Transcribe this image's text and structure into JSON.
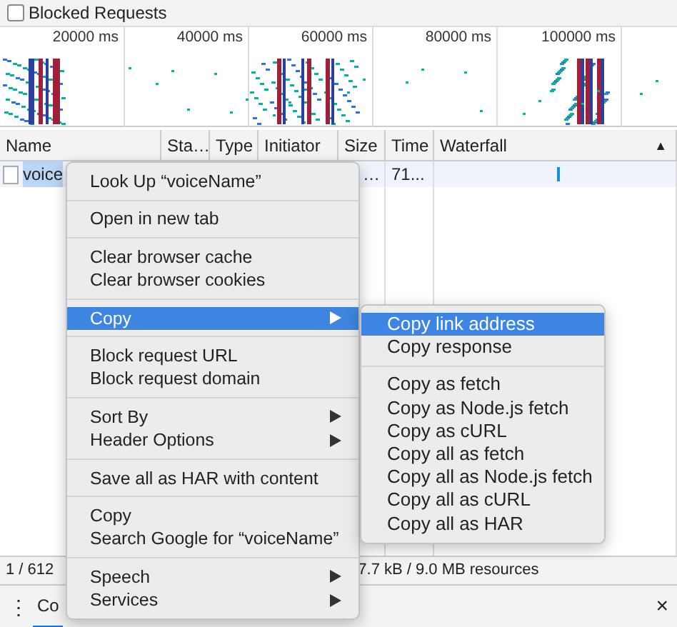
{
  "filter_bar": {
    "label": "Blocked Requests",
    "checked": false
  },
  "overview": {
    "ticks": [
      "20000 ms",
      "40000 ms",
      "60000 ms",
      "80000 ms",
      "100000 ms"
    ]
  },
  "table": {
    "columns": [
      {
        "label": "Name"
      },
      {
        "label": "Sta…"
      },
      {
        "label": "Type"
      },
      {
        "label": "Initiator"
      },
      {
        "label": "Size"
      },
      {
        "label": "Time"
      },
      {
        "label": "Waterfall"
      }
    ],
    "sort_indicator": "▲",
    "rows": [
      {
        "name": "voice",
        "size": "…",
        "time": "71...",
        "selected": true
      }
    ]
  },
  "status_bar": {
    "left": "1 / 612",
    "right": "7.7 kB / 9.0 MB resources"
  },
  "drawer": {
    "menu_glyph": "⋮",
    "tabs": [
      {
        "label": "Co",
        "selected": true
      }
    ],
    "close": "×"
  },
  "context_menu": {
    "groups": [
      [
        {
          "label": "Look Up “voiceName”",
          "submenu": false,
          "highlighted": false
        }
      ],
      [
        {
          "label": "Open in new tab",
          "submenu": false,
          "highlighted": false
        }
      ],
      [
        {
          "label": "Clear browser cache",
          "submenu": false,
          "highlighted": false
        },
        {
          "label": "Clear browser cookies",
          "submenu": false,
          "highlighted": false
        }
      ],
      [
        {
          "label": "Copy",
          "submenu": true,
          "highlighted": true
        }
      ],
      [
        {
          "label": "Block request URL",
          "submenu": false,
          "highlighted": false
        },
        {
          "label": "Block request domain",
          "submenu": false,
          "highlighted": false
        }
      ],
      [
        {
          "label": "Sort By",
          "submenu": true,
          "highlighted": false
        },
        {
          "label": "Header Options",
          "submenu": true,
          "highlighted": false
        }
      ],
      [
        {
          "label": "Save all as HAR with content",
          "submenu": false,
          "highlighted": false
        }
      ],
      [
        {
          "label": "Copy",
          "submenu": false,
          "highlighted": false
        },
        {
          "label": "Search Google for “voiceName”",
          "submenu": false,
          "highlighted": false
        }
      ],
      [
        {
          "label": "Speech",
          "submenu": true,
          "highlighted": false
        },
        {
          "label": "Services",
          "submenu": true,
          "highlighted": false
        }
      ]
    ]
  },
  "submenu": {
    "groups": [
      [
        {
          "label": "Copy link address",
          "highlighted": true
        },
        {
          "label": "Copy response",
          "highlighted": false
        }
      ],
      [
        {
          "label": "Copy as fetch",
          "highlighted": false
        },
        {
          "label": "Copy as Node.js fetch",
          "highlighted": false
        },
        {
          "label": "Copy as cURL",
          "highlighted": false
        },
        {
          "label": "Copy all as fetch",
          "highlighted": false
        },
        {
          "label": "Copy all as Node.js fetch",
          "highlighted": false
        },
        {
          "label": "Copy all as cURL",
          "highlighted": false
        },
        {
          "label": "Copy all as HAR",
          "highlighted": false
        }
      ]
    ]
  }
}
